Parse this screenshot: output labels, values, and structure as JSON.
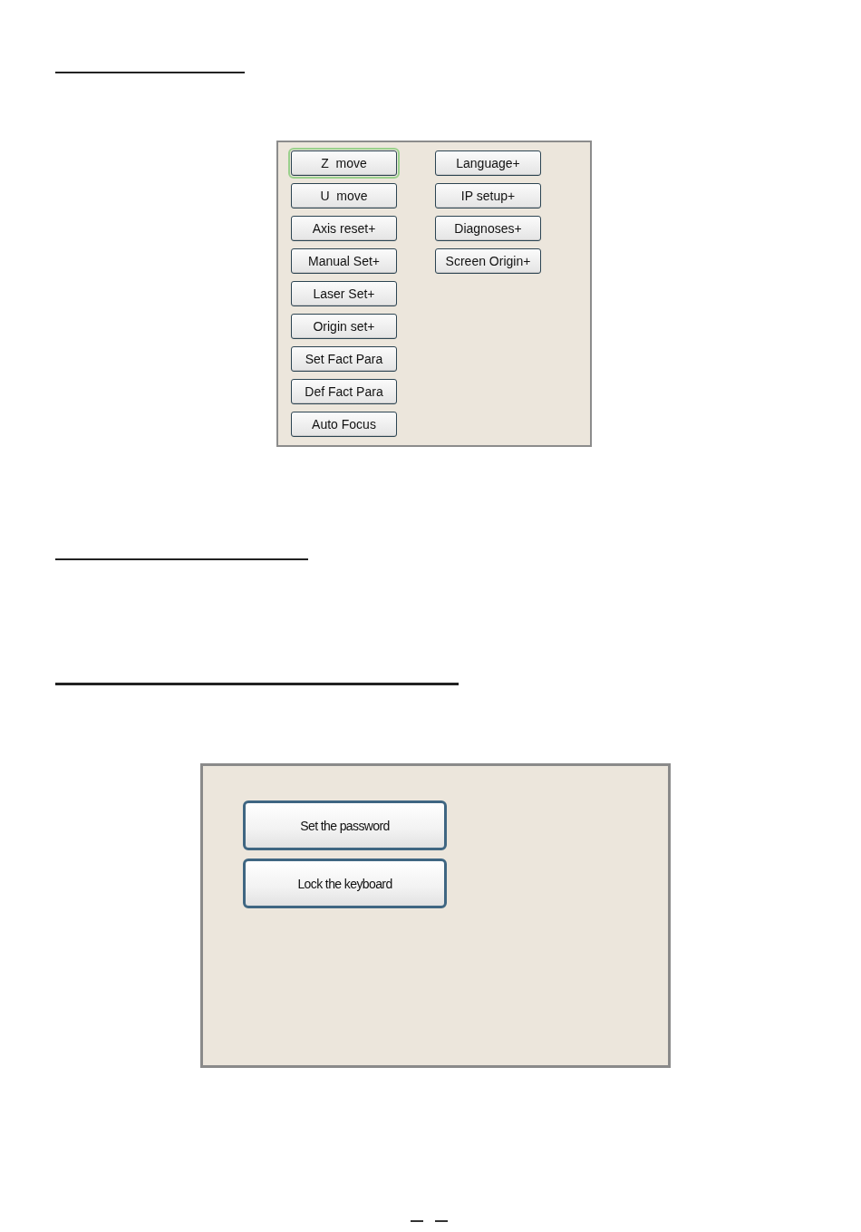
{
  "settings_menu": {
    "columns": [
      {
        "buttons": [
          {
            "label": "Z  move",
            "focused": true
          },
          {
            "label": "U  move",
            "focused": false
          },
          {
            "label": "Axis reset+",
            "focused": false
          },
          {
            "label": "Manual Set+",
            "focused": false
          },
          {
            "label": "Laser Set+",
            "focused": false
          },
          {
            "label": "Origin set+",
            "focused": false
          },
          {
            "label": "Set Fact Para",
            "focused": false
          },
          {
            "label": "Def Fact Para",
            "focused": false
          },
          {
            "label": "Auto Focus",
            "focused": false
          }
        ]
      },
      {
        "buttons": [
          {
            "label": "Language+",
            "focused": false
          },
          {
            "label": "IP setup+",
            "focused": false
          },
          {
            "label": "Diagnoses+",
            "focused": false
          },
          {
            "label": "Screen Origin+",
            "focused": false
          }
        ]
      }
    ]
  },
  "password_menu": {
    "buttons": [
      {
        "label": "Set the password"
      },
      {
        "label": "Lock the keyboard"
      }
    ]
  }
}
